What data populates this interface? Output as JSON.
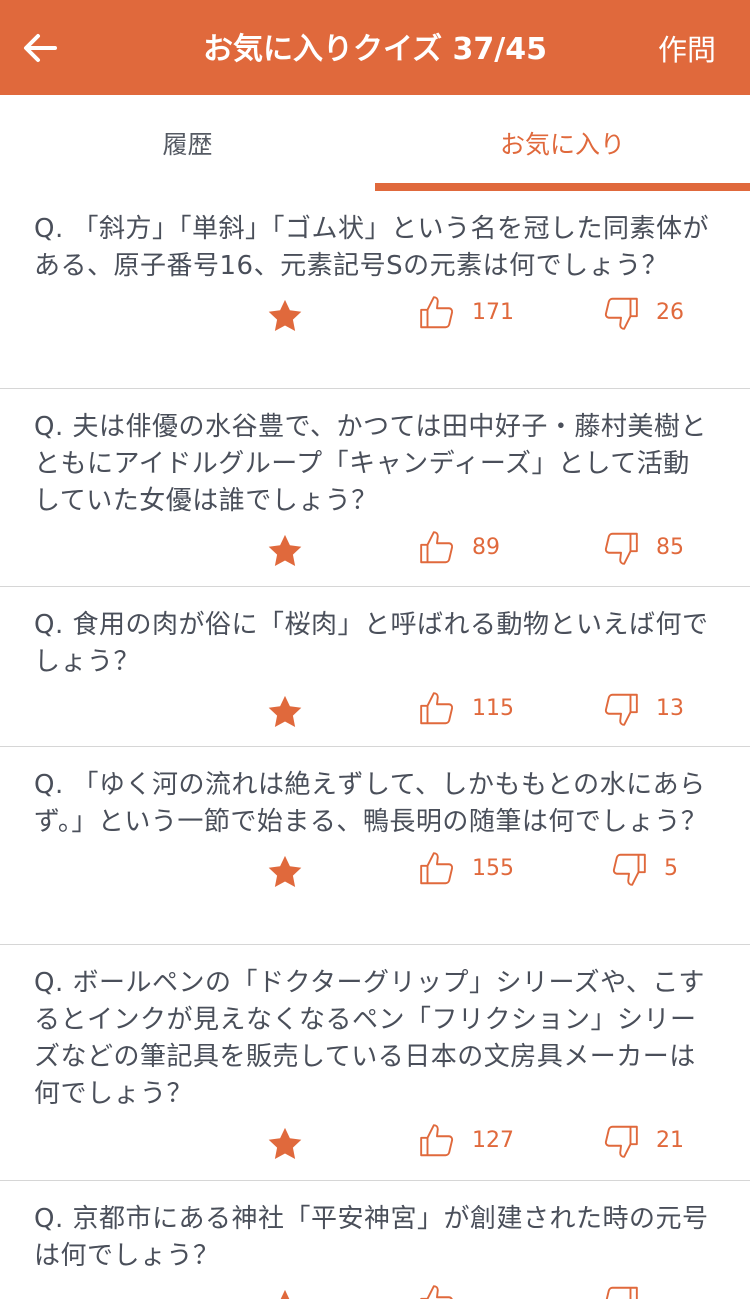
{
  "header": {
    "title": "お気に入りクイズ 37/45",
    "action_label": "作問"
  },
  "tabs": [
    {
      "label": "履歴",
      "active": false
    },
    {
      "label": "お気に入り",
      "active": true
    }
  ],
  "colors": {
    "accent": "#e0693c",
    "text": "#4a4f5a",
    "divider": "#d6d6d6"
  },
  "icons": {
    "back": "arrow-left-icon",
    "favorite": "star-icon",
    "like": "thumbs-up-icon",
    "dislike": "thumbs-down-icon"
  },
  "quizzes": [
    {
      "text": "Q. 「斜方」「単斜」「ゴム状」という名を冠した同素体がある、原子番号16、元素記号Sの元素は何でしょう？",
      "likes": "171",
      "dislikes": "26"
    },
    {
      "text": "Q. 夫は俳優の水谷豊で、かつては田中好子・藤村美樹とともにアイドルグループ「キャンディーズ」として活動していた女優は誰でしょう？",
      "likes": "89",
      "dislikes": "85"
    },
    {
      "text": "Q. 食用の肉が俗に「桜肉」と呼ばれる動物といえば何でしょう？",
      "likes": "115",
      "dislikes": "13"
    },
    {
      "text": "Q. 「ゆく河の流れは絶えずして、しかももとの水にあらず。」という一節で始まる、鴨長明の随筆は何でしょう？",
      "likes": "155",
      "dislikes": "5"
    },
    {
      "text": "Q. ボールペンの「ドクターグリップ」シリーズや、こするとインクが見えなくなるペン「フリクション」シリーズなどの筆記具を販売している日本の文房具メーカーは何でしょう？",
      "likes": "127",
      "dislikes": "21"
    },
    {
      "text": "Q. 京都市にある神社「平安神宮」が創建された時の元号は何でしょう？",
      "likes": "",
      "dislikes": ""
    }
  ]
}
